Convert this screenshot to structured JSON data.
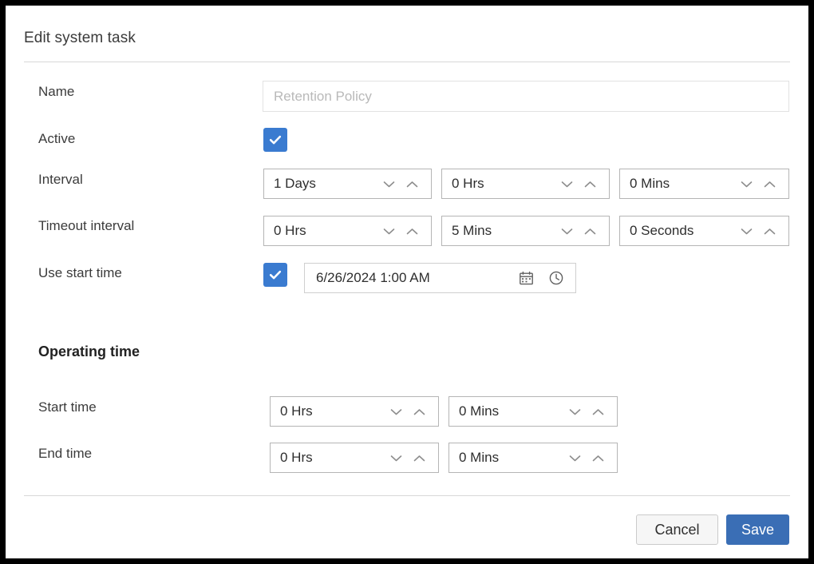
{
  "dialog": {
    "title": "Edit system task"
  },
  "colors": {
    "accent": "#3a7bd0",
    "save_button": "#3a6eb5",
    "border": "#b5b5b5",
    "placeholder_text": "#b9b9b9"
  },
  "fields": {
    "name": {
      "label": "Name",
      "value": "Retention Policy",
      "placeholder": "Retention Policy"
    },
    "active": {
      "label": "Active",
      "checked": true
    },
    "interval": {
      "label": "Interval",
      "days": "1 Days",
      "hours": "0 Hrs",
      "minutes": "0 Mins"
    },
    "timeout_interval": {
      "label": "Timeout interval",
      "hours": "0 Hrs",
      "minutes": "5 Mins",
      "seconds": "0 Seconds"
    },
    "use_start_time": {
      "label": "Use start time",
      "checked": true,
      "datetime": "6/26/2024 1:00 AM",
      "calendar_icon": "calendar-icon",
      "clock_icon": "clock-icon"
    }
  },
  "operating_time": {
    "heading": "Operating time",
    "start_time": {
      "label": "Start time",
      "hours": "0 Hrs",
      "minutes": "0 Mins"
    },
    "end_time": {
      "label": "End time",
      "hours": "0 Hrs",
      "minutes": "0 Mins"
    }
  },
  "footer": {
    "cancel_label": "Cancel",
    "save_label": "Save"
  },
  "icons": {
    "chevron_down": "chevron-down-icon",
    "chevron_up": "chevron-up-icon",
    "check": "check-icon"
  }
}
